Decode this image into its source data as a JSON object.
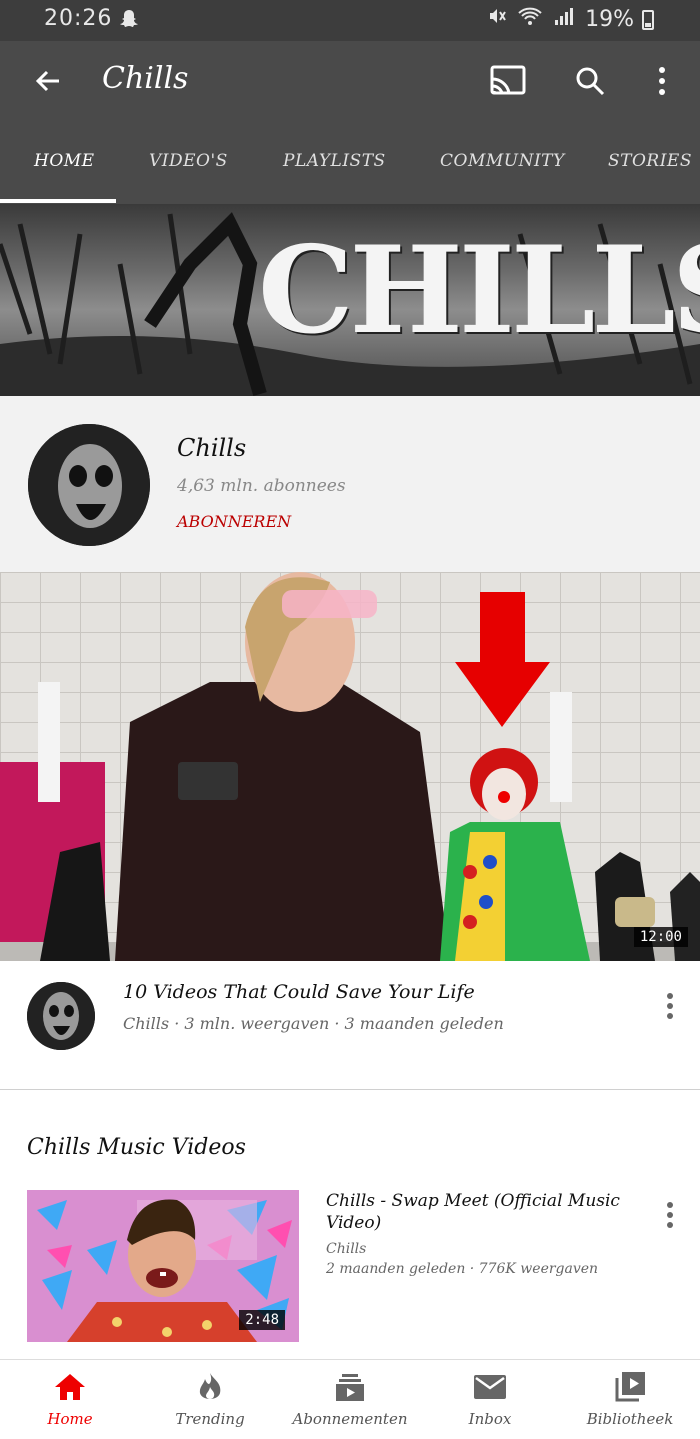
{
  "status_bar": {
    "time": "20:26",
    "battery": "19%"
  },
  "app_bar": {
    "title": "Chills",
    "icons": [
      "back-arrow-icon",
      "cast-icon",
      "search-icon",
      "more-vertical-icon"
    ]
  },
  "tabs": [
    {
      "label": "HOME",
      "active": true
    },
    {
      "label": "VIDEO'S",
      "active": false
    },
    {
      "label": "PLAYLISTS",
      "active": false
    },
    {
      "label": "COMMUNITY",
      "active": false
    },
    {
      "label": "STORIES",
      "active": false
    }
  ],
  "banner": {
    "text": "CHILLS"
  },
  "channel": {
    "name": "Chills",
    "subscribers": "4,63 mln. abonnees",
    "subscribe_label": "ABONNEREN"
  },
  "featured_video": {
    "duration": "12:00",
    "title": "10 Videos That Could Save Your Life",
    "meta": "Chills · 3 mln. weergaven · 3 maanden geleden"
  },
  "section": {
    "title": "Chills Music Videos",
    "items": [
      {
        "title": "Chills - Swap Meet (Official Music Video)",
        "channel": "Chills",
        "meta": "2 maanden geleden · 776K weergaven",
        "duration": "2:48"
      }
    ]
  },
  "bottom_nav": [
    {
      "label": "Home",
      "icon": "home-icon",
      "active": true
    },
    {
      "label": "Trending",
      "icon": "flame-icon",
      "active": false
    },
    {
      "label": "Abonnementen",
      "icon": "subscriptions-icon",
      "active": false
    },
    {
      "label": "Inbox",
      "icon": "mail-icon",
      "active": false
    },
    {
      "label": "Bibliotheek",
      "icon": "library-icon",
      "active": false
    }
  ],
  "colors": {
    "app_bar": "#4a4a4a",
    "accent_red": "#e00000",
    "subscribe_red": "#b00000"
  }
}
